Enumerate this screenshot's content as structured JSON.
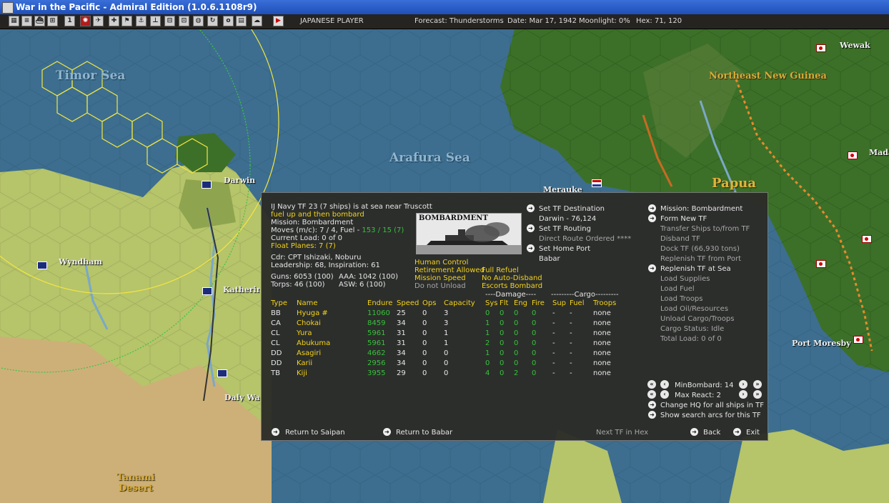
{
  "window": {
    "title": "War in the Pacific - Admiral Edition (1.0.6.1108r9)"
  },
  "toolbar": {
    "buttons": [
      "map-icon",
      "list-icon",
      "ship-icon",
      "group-icon",
      "info-icon",
      "flag-icon",
      "plane-icon",
      "base-icon",
      "bomb-icon",
      "cargo-icon",
      "fleet-icon",
      "globe-icon",
      "reload-icon",
      "report-icon",
      "calendar-icon",
      "cloud-icon",
      "end-turn-icon"
    ],
    "player": "JAPANESE PLAYER",
    "forecast": "Forecast: Thunderstorms",
    "date": "Date: Mar 17, 1942",
    "moonlight": "Moonlight: 0%",
    "hex": "Hex: 71, 120"
  },
  "map": {
    "seas": [
      "Timor Sea",
      "Arafura Sea"
    ],
    "regions": [
      "Northeast New Guinea",
      "Papua",
      "Tanami Desert"
    ],
    "places": [
      "Darwin",
      "Wyndham",
      "Katherine",
      "Daly Waters",
      "Merauke",
      "Wewak",
      "Madang",
      "Port Moresby"
    ]
  },
  "tf": {
    "header": "IJ Navy TF 23 (7 ships) is at sea near Truscott",
    "orders": "fuel up and then bombard",
    "mission": "Mission: Bombardment",
    "moves_label": "Moves (m/c): 7 / 4, Fuel - ",
    "moves_fuel": "153 / 15 (7)",
    "current_load": "Current Load: 0 of 0",
    "float_planes": "Float Planes: 7 (7)",
    "cdr": "Cdr: CPT Ishizaki, Noburu",
    "leadership": "Leadership: 68, Inspiration: 61",
    "guns": "Guns: 6053 (100)",
    "aaa": "AAA: 1042 (100)",
    "torps": "Torps: 46 (100)",
    "asw": "ASW: 6 (100)",
    "mission_picture_label": "BOMBARDMENT",
    "status": {
      "human_control": "Human Control",
      "retirement": "Retirement Allowed",
      "mission_speed": "Mission Speed",
      "unload": "Do not Unload",
      "full_refuel": "Full Refuel",
      "auto_disband": "No Auto-Disband",
      "escorts": "Escorts Bombard"
    },
    "dest": {
      "set_destination": "Set TF Destination",
      "destination": "Darwin - 76,124",
      "set_routing": "Set TF Routing",
      "route": "Direct Route Ordered ****",
      "set_home": "Set Home Port",
      "home": "Babar"
    },
    "commands": {
      "mission": "Mission: Bombardment",
      "form_new": "Form New TF",
      "transfer": "Transfer Ships to/from TF",
      "disband": "Disband TF",
      "dock": "Dock TF (66,930 tons)",
      "replenish_port": "Replenish TF from Port",
      "replenish_sea": "Replenish TF at Sea",
      "load_supplies": "Load Supplies",
      "load_fuel": "Load Fuel",
      "load_troops": "Load Troops",
      "load_oil": "Load Oil/Resources",
      "unload": "Unload Cargo/Troops",
      "cargo_status": "Cargo Status: Idle",
      "total_load": "Total Load: 0 of 0"
    },
    "group_headers": {
      "damage": "----Damage----",
      "cargo": "---------Cargo---------"
    },
    "columns": [
      "Type",
      "Name",
      "Endure",
      "Speed",
      "Ops",
      "Capacity",
      "Sys",
      "Flt",
      "Eng",
      "Fire",
      "Sup",
      "Fuel",
      "Troops"
    ],
    "ships": [
      {
        "type": "BB",
        "name": "Hyuga #",
        "endure": "11060",
        "speed": "25",
        "ops": "0",
        "capacity": "3",
        "sys": "0",
        "flt": "0",
        "eng": "0",
        "fire": "0",
        "sup": "-",
        "fuel": "-",
        "troops": "none"
      },
      {
        "type": "CA",
        "name": "Chokai",
        "endure": "8459",
        "speed": "34",
        "ops": "0",
        "capacity": "3",
        "sys": "1",
        "flt": "0",
        "eng": "0",
        "fire": "0",
        "sup": "-",
        "fuel": "-",
        "troops": "none"
      },
      {
        "type": "CL",
        "name": "Yura",
        "endure": "5961",
        "speed": "31",
        "ops": "0",
        "capacity": "1",
        "sys": "1",
        "flt": "0",
        "eng": "0",
        "fire": "0",
        "sup": "-",
        "fuel": "-",
        "troops": "none"
      },
      {
        "type": "CL",
        "name": "Abukuma",
        "endure": "5961",
        "speed": "31",
        "ops": "0",
        "capacity": "1",
        "sys": "2",
        "flt": "0",
        "eng": "0",
        "fire": "0",
        "sup": "-",
        "fuel": "-",
        "troops": "none"
      },
      {
        "type": "DD",
        "name": "Asagiri",
        "endure": "4662",
        "speed": "34",
        "ops": "0",
        "capacity": "0",
        "sys": "1",
        "flt": "0",
        "eng": "0",
        "fire": "0",
        "sup": "-",
        "fuel": "-",
        "troops": "none"
      },
      {
        "type": "DD",
        "name": "Karii",
        "endure": "2956",
        "speed": "34",
        "ops": "0",
        "capacity": "0",
        "sys": "0",
        "flt": "0",
        "eng": "0",
        "fire": "0",
        "sup": "-",
        "fuel": "-",
        "troops": "none"
      },
      {
        "type": "TB",
        "name": "Kiji",
        "endure": "3955",
        "speed": "29",
        "ops": "0",
        "capacity": "0",
        "sys": "4",
        "flt": "0",
        "eng": "2",
        "fire": "0",
        "sup": "-",
        "fuel": "-",
        "troops": "none"
      }
    ],
    "controls": {
      "min_bombard": "MinBombard: 14",
      "max_react": "Max React: 2",
      "change_hq": "Change HQ for all ships in TF",
      "show_arcs": "Show search arcs for this TF"
    },
    "footer": {
      "return_saipan": "Return to Saipan",
      "return_babar": "Return to Babar",
      "next_tf": "Next TF in Hex",
      "back": "Back",
      "exit": "Exit"
    }
  },
  "colors": {
    "land": "#b6c46a",
    "jungle": "#3c7028",
    "sea": "#3d6e8f",
    "highlight": "#f2d21b",
    "value_green": "#36c23a"
  }
}
